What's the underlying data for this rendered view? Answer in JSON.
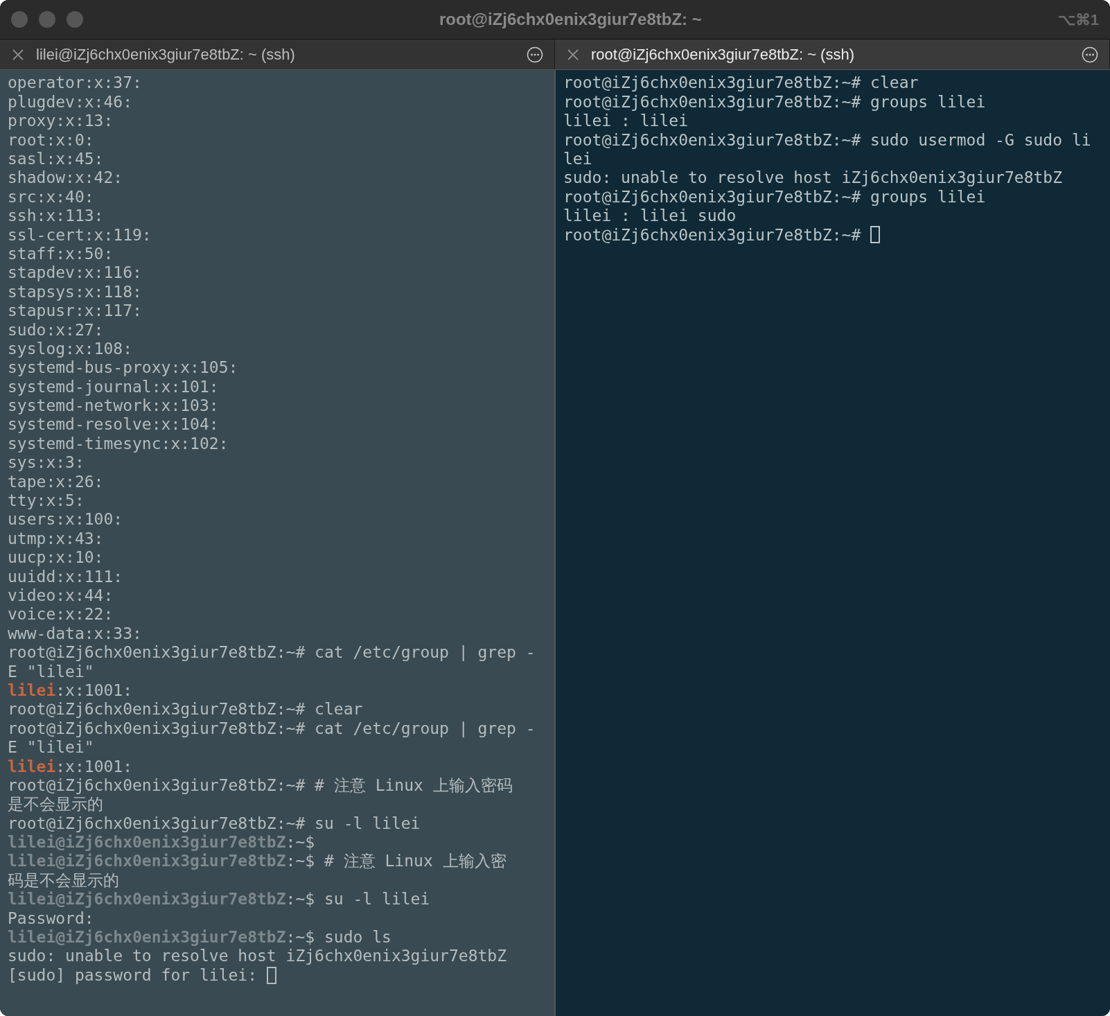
{
  "window": {
    "title": "root@iZj6chx0enix3giur7e8tbZ: ~",
    "shortcut": "⌥⌘1"
  },
  "tabs": [
    {
      "label": "lilei@iZj6chx0enix3giur7e8tbZ: ~ (ssh)",
      "selected": false
    },
    {
      "label": "root@iZj6chx0enix3giur7e8tbZ: ~ (ssh)",
      "selected": true
    }
  ],
  "panes": [
    {
      "lines": [
        {
          "segments": [
            {
              "kind": "text",
              "text": "operator:x:37:"
            }
          ]
        },
        {
          "segments": [
            {
              "kind": "text",
              "text": "plugdev:x:46:"
            }
          ]
        },
        {
          "segments": [
            {
              "kind": "text",
              "text": "proxy:x:13:"
            }
          ]
        },
        {
          "segments": [
            {
              "kind": "text",
              "text": "root:x:0:"
            }
          ]
        },
        {
          "segments": [
            {
              "kind": "text",
              "text": "sasl:x:45:"
            }
          ]
        },
        {
          "segments": [
            {
              "kind": "text",
              "text": "shadow:x:42:"
            }
          ]
        },
        {
          "segments": [
            {
              "kind": "text",
              "text": "src:x:40:"
            }
          ]
        },
        {
          "segments": [
            {
              "kind": "text",
              "text": "ssh:x:113:"
            }
          ]
        },
        {
          "segments": [
            {
              "kind": "text",
              "text": "ssl-cert:x:119:"
            }
          ]
        },
        {
          "segments": [
            {
              "kind": "text",
              "text": "staff:x:50:"
            }
          ]
        },
        {
          "segments": [
            {
              "kind": "text",
              "text": "stapdev:x:116:"
            }
          ]
        },
        {
          "segments": [
            {
              "kind": "text",
              "text": "stapsys:x:118:"
            }
          ]
        },
        {
          "segments": [
            {
              "kind": "text",
              "text": "stapusr:x:117:"
            }
          ]
        },
        {
          "segments": [
            {
              "kind": "text",
              "text": "sudo:x:27:"
            }
          ]
        },
        {
          "segments": [
            {
              "kind": "text",
              "text": "syslog:x:108:"
            }
          ]
        },
        {
          "segments": [
            {
              "kind": "text",
              "text": "systemd-bus-proxy:x:105:"
            }
          ]
        },
        {
          "segments": [
            {
              "kind": "text",
              "text": "systemd-journal:x:101:"
            }
          ]
        },
        {
          "segments": [
            {
              "kind": "text",
              "text": "systemd-network:x:103:"
            }
          ]
        },
        {
          "segments": [
            {
              "kind": "text",
              "text": "systemd-resolve:x:104:"
            }
          ]
        },
        {
          "segments": [
            {
              "kind": "text",
              "text": "systemd-timesync:x:102:"
            }
          ]
        },
        {
          "segments": [
            {
              "kind": "text",
              "text": "sys:x:3:"
            }
          ]
        },
        {
          "segments": [
            {
              "kind": "text",
              "text": "tape:x:26:"
            }
          ]
        },
        {
          "segments": [
            {
              "kind": "text",
              "text": "tty:x:5:"
            }
          ]
        },
        {
          "segments": [
            {
              "kind": "text",
              "text": "users:x:100:"
            }
          ]
        },
        {
          "segments": [
            {
              "kind": "text",
              "text": "utmp:x:43:"
            }
          ]
        },
        {
          "segments": [
            {
              "kind": "text",
              "text": "uucp:x:10:"
            }
          ]
        },
        {
          "segments": [
            {
              "kind": "text",
              "text": "uuidd:x:111:"
            }
          ]
        },
        {
          "segments": [
            {
              "kind": "text",
              "text": "video:x:44:"
            }
          ]
        },
        {
          "segments": [
            {
              "kind": "text",
              "text": "voice:x:22:"
            }
          ]
        },
        {
          "segments": [
            {
              "kind": "text",
              "text": "www-data:x:33:"
            }
          ]
        },
        {
          "segments": [
            {
              "kind": "text",
              "text": "root@iZj6chx0enix3giur7e8tbZ:~# cat /etc/group | grep -"
            }
          ]
        },
        {
          "segments": [
            {
              "kind": "text",
              "text": "E \"lilei\""
            }
          ]
        },
        {
          "segments": [
            {
              "kind": "match",
              "text": "lilei"
            },
            {
              "kind": "text",
              "text": ":x:1001:"
            }
          ]
        },
        {
          "segments": [
            {
              "kind": "text",
              "text": "root@iZj6chx0enix3giur7e8tbZ:~# clear"
            }
          ]
        },
        {
          "segments": [
            {
              "kind": "text",
              "text": "root@iZj6chx0enix3giur7e8tbZ:~# cat /etc/group | grep -"
            }
          ]
        },
        {
          "segments": [
            {
              "kind": "text",
              "text": "E \"lilei\""
            }
          ]
        },
        {
          "segments": [
            {
              "kind": "match",
              "text": "lilei"
            },
            {
              "kind": "text",
              "text": ":x:1001:"
            }
          ]
        },
        {
          "segments": [
            {
              "kind": "text",
              "text": "root@iZj6chx0enix3giur7e8tbZ:~# # 注意 Linux 上输入密码"
            }
          ]
        },
        {
          "segments": [
            {
              "kind": "text",
              "text": "是不会显示的"
            }
          ]
        },
        {
          "segments": [
            {
              "kind": "text",
              "text": "root@iZj6chx0enix3giur7e8tbZ:~# su -l lilei"
            }
          ]
        },
        {
          "segments": [
            {
              "kind": "prompt",
              "text": "lilei@iZj6chx0enix3giur7e8tbZ"
            },
            {
              "kind": "text",
              "text": ":~$"
            }
          ]
        },
        {
          "segments": [
            {
              "kind": "prompt",
              "text": "lilei@iZj6chx0enix3giur7e8tbZ"
            },
            {
              "kind": "text",
              "text": ":~$ # 注意 Linux 上输入密"
            }
          ]
        },
        {
          "segments": [
            {
              "kind": "text",
              "text": "码是不会显示的"
            }
          ]
        },
        {
          "segments": [
            {
              "kind": "prompt",
              "text": "lilei@iZj6chx0enix3giur7e8tbZ"
            },
            {
              "kind": "text",
              "text": ":~$ su -l lilei"
            }
          ]
        },
        {
          "segments": [
            {
              "kind": "text",
              "text": "Password:"
            }
          ]
        },
        {
          "segments": [
            {
              "kind": "prompt",
              "text": "lilei@iZj6chx0enix3giur7e8tbZ"
            },
            {
              "kind": "text",
              "text": ":~$ sudo ls"
            }
          ]
        },
        {
          "segments": [
            {
              "kind": "text",
              "text": "sudo: unable to resolve host iZj6chx0enix3giur7e8tbZ"
            }
          ]
        },
        {
          "segments": [
            {
              "kind": "text",
              "text": "[sudo] password for lilei: "
            },
            {
              "kind": "cursor"
            }
          ]
        }
      ]
    },
    {
      "lines": [
        {
          "segments": [
            {
              "kind": "text",
              "text": "root@iZj6chx0enix3giur7e8tbZ:~# clear"
            }
          ]
        },
        {
          "segments": [
            {
              "kind": "text",
              "text": "root@iZj6chx0enix3giur7e8tbZ:~# groups lilei"
            }
          ]
        },
        {
          "segments": [
            {
              "kind": "text",
              "text": "lilei : lilei"
            }
          ]
        },
        {
          "segments": [
            {
              "kind": "text",
              "text": "root@iZj6chx0enix3giur7e8tbZ:~# sudo usermod -G sudo li"
            }
          ]
        },
        {
          "segments": [
            {
              "kind": "text",
              "text": "lei"
            }
          ]
        },
        {
          "segments": [
            {
              "kind": "text",
              "text": "sudo: unable to resolve host iZj6chx0enix3giur7e8tbZ"
            }
          ]
        },
        {
          "segments": [
            {
              "kind": "text",
              "text": "root@iZj6chx0enix3giur7e8tbZ:~# groups lilei"
            }
          ]
        },
        {
          "segments": [
            {
              "kind": "text",
              "text": "lilei : lilei sudo"
            }
          ]
        },
        {
          "segments": [
            {
              "kind": "text",
              "text": "root@iZj6chx0enix3giur7e8tbZ:~# "
            },
            {
              "kind": "cursor"
            }
          ]
        }
      ]
    }
  ]
}
